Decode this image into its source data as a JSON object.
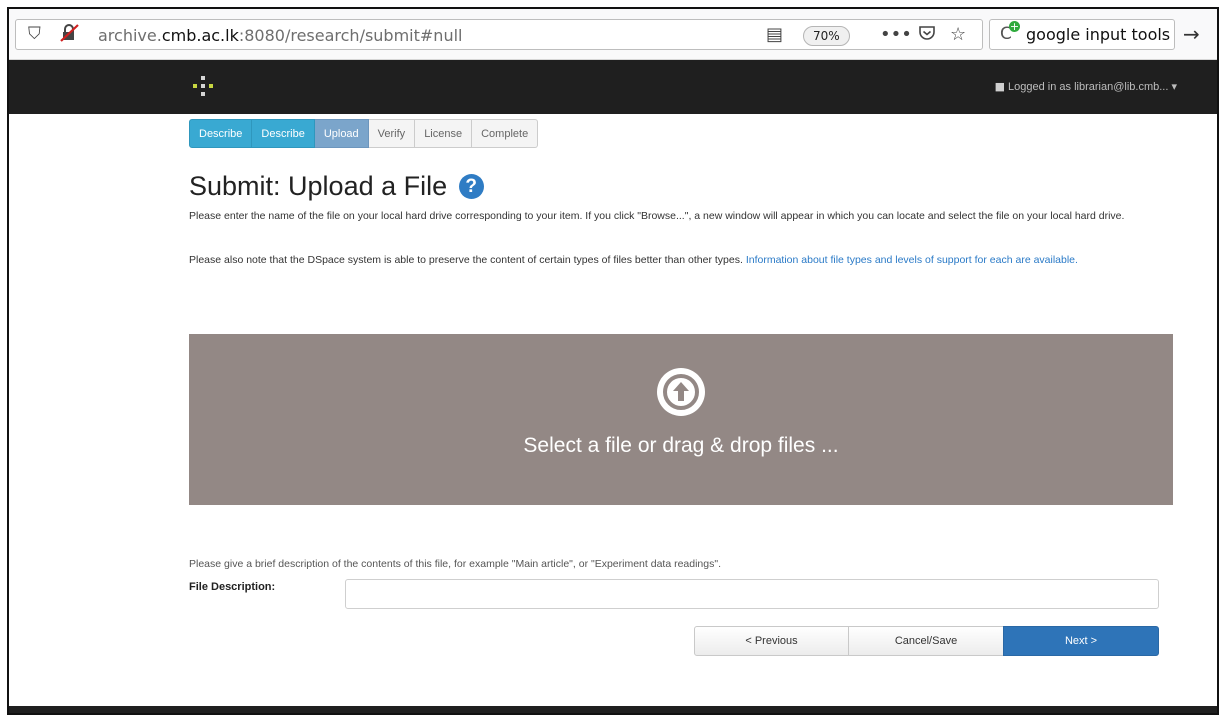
{
  "browser": {
    "url_prefix": "archive.",
    "url_host": "cmb.ac.lk",
    "url_rest": ":8080/research/submit#null",
    "zoom": "70%",
    "search_query": "google input tools",
    "icons": {
      "shield": "shield-icon",
      "insecure": "insecure-lock-icon",
      "reader": "reader-view-icon",
      "more": "more-icon",
      "pocket": "pocket-icon",
      "bookmark": "star-icon",
      "search_engine": "google-input-tools-icon",
      "go": "arrow-right-icon"
    }
  },
  "header": {
    "user_label": "Logged in as librarian@lib.cmb...",
    "dropdown_caret": "▾"
  },
  "steps": [
    {
      "label": "Describe",
      "state": "done"
    },
    {
      "label": "Describe",
      "state": "done"
    },
    {
      "label": "Upload",
      "state": "current"
    },
    {
      "label": "Verify",
      "state": "todo"
    },
    {
      "label": "License",
      "state": "todo"
    },
    {
      "label": "Complete",
      "state": "todo"
    }
  ],
  "main": {
    "title": "Submit: Upload a File",
    "help_glyph": "?",
    "intro_1": "Please enter the name of the file on your local hard drive corresponding to your item. If you click \"Browse...\", a new window will appear in which you can locate and select the file on your local hard drive.",
    "intro_2_text": "Please also note that the DSpace system is able to preserve the content of certain types of files better than other types. ",
    "intro_2_link": "Information about file types and levels of support for each are available.",
    "dropzone_text": "Select a file or drag & drop files ...",
    "description_hint": "Please give a brief description of the contents of this file, for example \"Main article\", or \"Experiment data readings\".",
    "file_description_label": "File Description:",
    "file_description_value": ""
  },
  "buttons": {
    "previous": "< Previous",
    "cancel_save": "Cancel/Save",
    "next": "Next >"
  },
  "colors": {
    "step_done": "#39a9d2",
    "step_current": "#7ba5cb",
    "dropzone": "#938885",
    "primary_button": "#2e74b8",
    "link": "#2a7ac7",
    "navbar": "#1f1f1f"
  }
}
